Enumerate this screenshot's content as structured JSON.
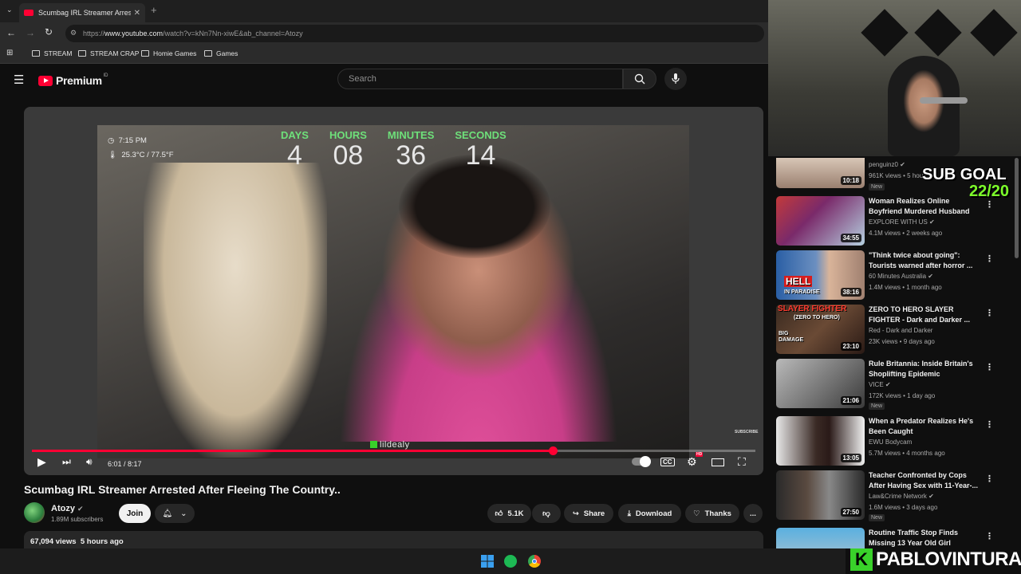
{
  "browser": {
    "tab_title": "Scumbag IRL Streamer Arrested...",
    "new_tab": "+",
    "url_prefix": "https://",
    "url_host": "www.youtube.com",
    "url_path": "/watch?v=kNn7Nn-xiwE&ab_channel=Atozy",
    "bookmarks": [
      "STREAM",
      "STREAM CRAP",
      "Homie Games",
      "Games"
    ]
  },
  "youtube": {
    "logo_text": "Premium",
    "logo_region": "ID",
    "search_placeholder": "Search"
  },
  "player": {
    "clock": "7:15 PM",
    "temperature": "25.3°C / 77.5°F",
    "countdown": [
      {
        "label": "DAYS",
        "value": "4"
      },
      {
        "label": "HOURS",
        "value": "08"
      },
      {
        "label": "MINUTES",
        "value": "36"
      },
      {
        "label": "SECONDS",
        "value": "14"
      }
    ],
    "watermark": "lildealy",
    "subscribe_badge": "SUBSCRIBE",
    "time_display": "6:01 / 8:17",
    "progress_fraction": 0.72,
    "hd_badge": "HD"
  },
  "video": {
    "title": "Scumbag IRL Streamer Arrested After Fleeing The Country..",
    "channel": "Atozy",
    "subscribers": "1.89M subscribers",
    "join_label": "Join",
    "likes": "5.1K",
    "share_label": "Share",
    "download_label": "Download",
    "thanks_label": "Thanks",
    "more_label": "...",
    "views": "67,094 views",
    "age": "5 hours ago"
  },
  "overlay": {
    "sub_goal_label": "SUB GOAL",
    "sub_goal_value": "22/20",
    "streamer_name": "PABLOVINTURA",
    "streamer_logo": "K"
  },
  "recommendations": [
    {
      "title": "",
      "channel": "penguinz0",
      "verified": true,
      "meta": "961K views • 5 hou",
      "duration": "10:18",
      "badge": "New"
    },
    {
      "title": "Woman Realizes Online Boyfriend Murdered Husband",
      "channel": "EXPLORE WITH US",
      "verified": true,
      "meta": "4.1M views • 2 weeks ago",
      "duration": "34:55",
      "badge": ""
    },
    {
      "title": "\"Think twice about going\": Tourists warned after horror ...",
      "channel": "60 Minutes Australia",
      "verified": true,
      "meta": "1.4M views • 1 month ago",
      "duration": "38:16",
      "badge": "",
      "thumb_text": "HELL",
      "thumb_sub": "IN PARADISE"
    },
    {
      "title": "ZERO TO HERO SLAYER FIGHTER - Dark and Darker ...",
      "channel": "Red - Dark and Darker",
      "verified": false,
      "meta": "23K views • 9 days ago",
      "duration": "23:10",
      "badge": "",
      "thumb_text": "SLAYER FIGHTER",
      "thumb_sub": "(ZERO TO HERO)",
      "thumb_sub2": "BIG DAMAGE"
    },
    {
      "title": "Rule Britannia: Inside Britain's Shoplifting Epidemic",
      "channel": "VICE",
      "verified": true,
      "meta": "172K views • 1 day ago",
      "duration": "21:06",
      "badge": "New"
    },
    {
      "title": "When a Predator Realizes He's Been Caught",
      "channel": "EWU Bodycam",
      "verified": false,
      "meta": "5.7M views • 4 months ago",
      "duration": "13:05",
      "badge": ""
    },
    {
      "title": "Teacher Confronted by Cops After Having Sex with 11-Year-...",
      "channel": "Law&Crime Network",
      "verified": true,
      "meta": "1.6M views • 3 days ago",
      "duration": "27:50",
      "badge": "New"
    },
    {
      "title": "Routine Traffic Stop Finds Missing 13 Year Old Girl",
      "channel": "",
      "verified": false,
      "meta": "",
      "duration": "",
      "badge": ""
    }
  ],
  "colors": {
    "accent": "#ff0033",
    "countdown_label": "#6ee07a",
    "sub_goal": "#7cfc2a",
    "kick_green": "#39d12a"
  }
}
